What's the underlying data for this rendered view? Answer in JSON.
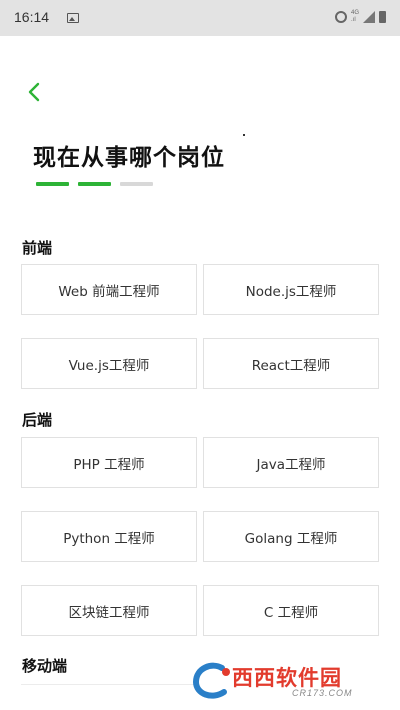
{
  "status_bar": {
    "time": "16:14",
    "network_label": "4G\n.ıl"
  },
  "header": {
    "back_icon": "chevron-left-icon",
    "title": "现在从事哪个岗位"
  },
  "progress": {
    "steps_total": 3,
    "steps_done": 2,
    "active_color": "#2db336",
    "inactive_color": "#d8d8d8"
  },
  "sections": [
    {
      "heading": "前端",
      "options": [
        "Web 前端工程师",
        "Node.js工程师",
        "Vue.js工程师",
        "React工程师"
      ]
    },
    {
      "heading": "后端",
      "options": [
        "PHP 工程师",
        "Java工程师",
        "Python 工程师",
        "Golang 工程师",
        "区块链工程师",
        "C 工程师"
      ]
    },
    {
      "heading": "移动端",
      "options": []
    }
  ],
  "watermark": {
    "text": "西西软件园",
    "sub": "CR173.COM"
  }
}
